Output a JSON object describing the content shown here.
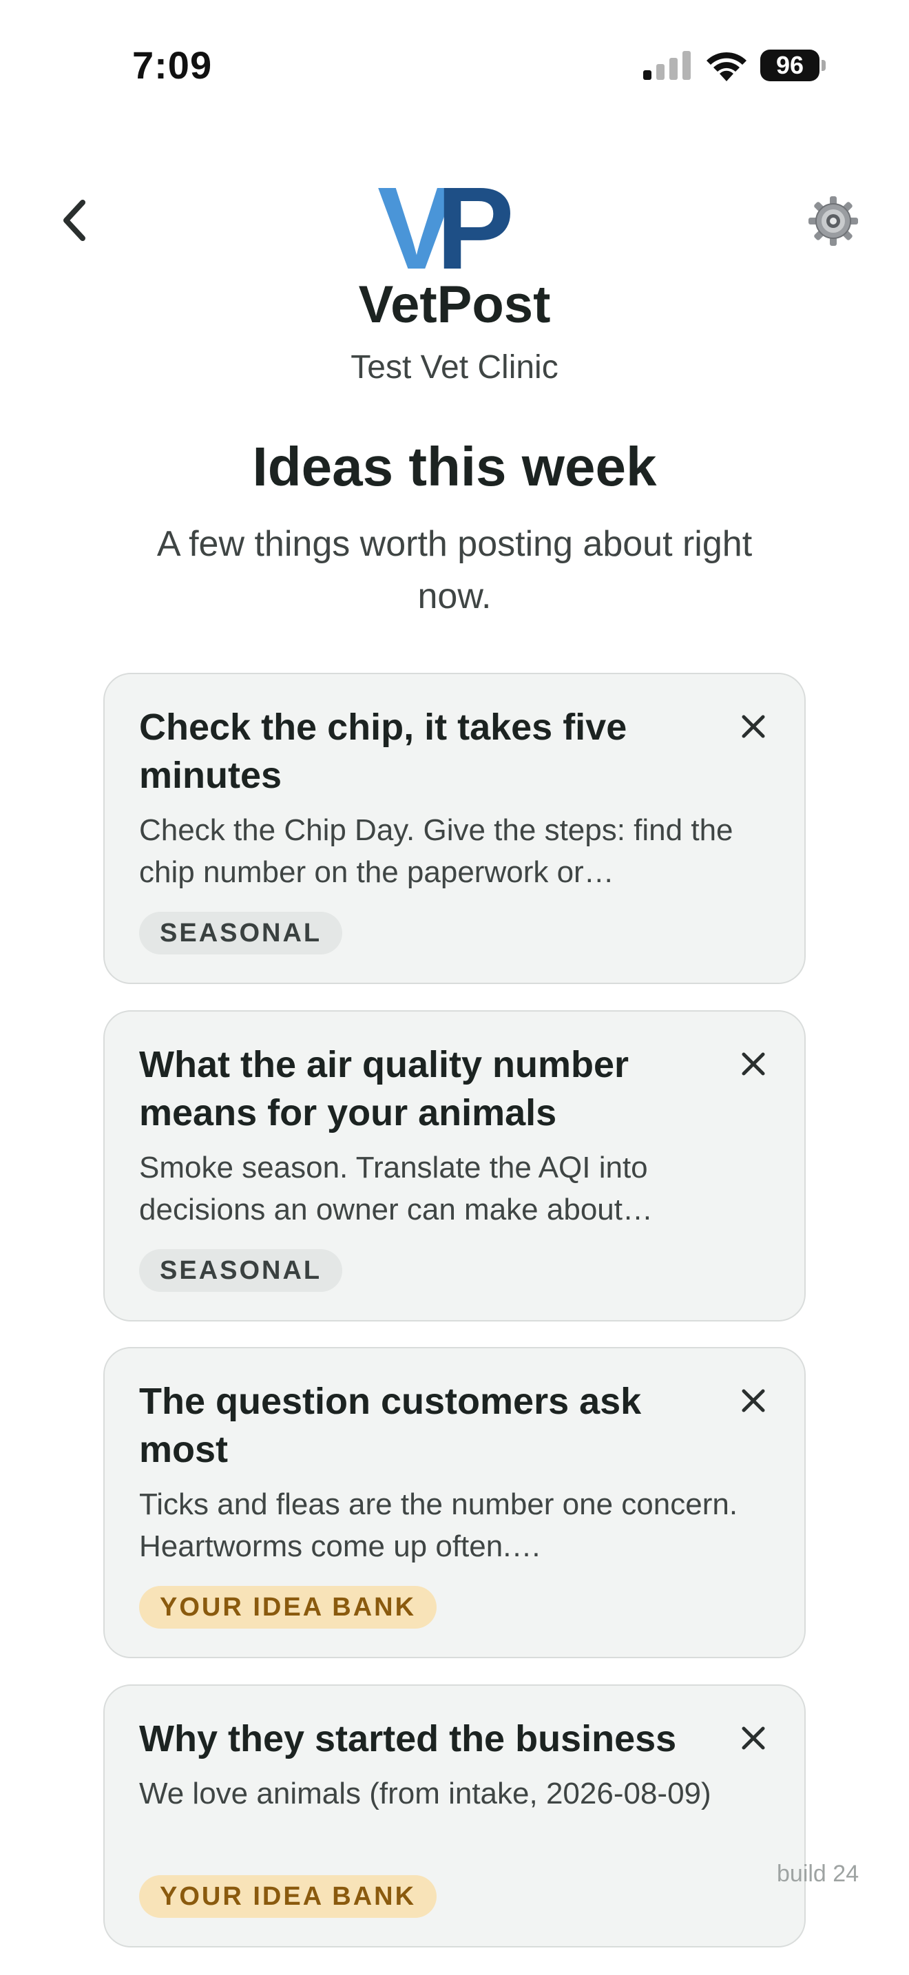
{
  "status_bar": {
    "time": "7:09",
    "battery": "96"
  },
  "header": {
    "brand": "VetPost",
    "clinic": "Test Vet Clinic",
    "logo_text": "VP",
    "logo_colors": [
      "#4a95d8",
      "#1e4f86"
    ]
  },
  "page": {
    "title": "Ideas this week",
    "subtitle": "A few things worth posting about right now."
  },
  "cards": [
    {
      "title": "Check the chip, it takes five minutes",
      "description": "Check the Chip Day. Give the steps: find the chip number on the paperwork or…",
      "tag": "SEASONAL"
    },
    {
      "title": "What the air quality number means for your animals",
      "description": "Smoke season. Translate the AQI into decisions an owner can make about…",
      "tag": "SEASONAL"
    },
    {
      "title": "The question customers ask most",
      "description": "Ticks and fleas are the number one concern. Heartworms come up often.…",
      "tag": "YOUR IDEA BANK"
    },
    {
      "title": "Why they started the business",
      "description": "We love animals (from intake, 2026-08-09)",
      "tag": "YOUR IDEA BANK"
    }
  ],
  "footer": {
    "build": "build 24"
  },
  "icons": {
    "back": "chevron-left-icon",
    "settings": "gear-icon",
    "dismiss": "close-icon"
  }
}
